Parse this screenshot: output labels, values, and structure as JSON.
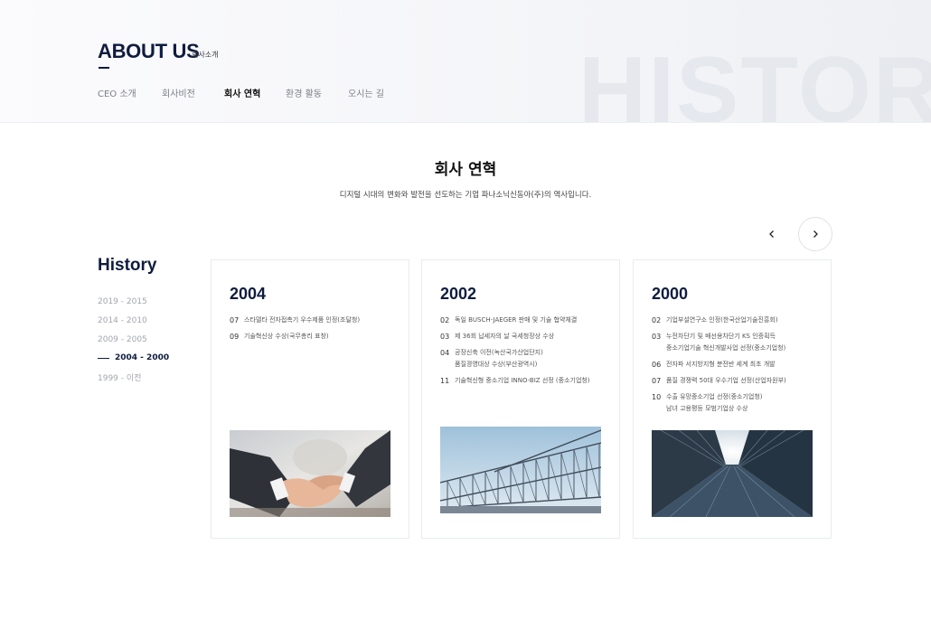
{
  "header": {
    "title": "ABOUT US",
    "subtitle": "회사소개",
    "background_word": "HISTORY",
    "tabs": [
      {
        "label": "CEO 소개",
        "active": false
      },
      {
        "label": "회사비전",
        "active": false
      },
      {
        "label": "회사 연혁",
        "active": true
      },
      {
        "label": "환경 활동",
        "active": false
      },
      {
        "label": "오시는 길",
        "active": false
      }
    ]
  },
  "section": {
    "title": "회사 연혁",
    "description": "디지털 시대의 변화와 발전을 선도하는 기업 파나소닉신동아(주)의 역사입니다."
  },
  "slider": {
    "prev_icon": "chevron-left-icon",
    "next_icon": "chevron-right-icon"
  },
  "history": {
    "title": "History",
    "periods": [
      {
        "label": "2019 - 2015",
        "active": false
      },
      {
        "label": "2014 - 2010",
        "active": false
      },
      {
        "label": "2009 - 2005",
        "active": false
      },
      {
        "label": "2004 - 2000",
        "active": true
      },
      {
        "label": "1999 - 이전",
        "active": false
      }
    ]
  },
  "cards": [
    {
      "year": "2004",
      "image": "handshake-photo",
      "entries": [
        {
          "month": "07",
          "lines": [
            "스타델타 전자접촉기 우수제품 인정(조달청)"
          ]
        },
        {
          "month": "09",
          "lines": [
            "기술혁신상 수상(국무총리 표창)"
          ]
        }
      ]
    },
    {
      "year": "2002",
      "image": "steel-frame-photo",
      "entries": [
        {
          "month": "02",
          "lines": [
            "독일 BUSCH-JAEGER 판매 및 기술 협약체결"
          ]
        },
        {
          "month": "03",
          "lines": [
            "제 36회 납세자의 날 국세청장상 수상"
          ]
        },
        {
          "month": "04",
          "lines": [
            "공장신축 이전(녹산국가산업단지)",
            "품질경영대상 수상(부산광역시)"
          ]
        },
        {
          "month": "11",
          "lines": [
            "기술혁신형 중소기업 INNO-BIZ 선정 (중소기업청)"
          ]
        }
      ]
    },
    {
      "year": "2000",
      "image": "skyscraper-photo",
      "entries": [
        {
          "month": "02",
          "lines": [
            "기업부설연구소 인정(한국산업기술진흥회)"
          ]
        },
        {
          "month": "03",
          "lines": [
            "누전차단기 및 배선용차단기 KS 인증획득",
            "중소기업기술 혁신개발사업 선정(중소기업청)"
          ]
        },
        {
          "month": "06",
          "lines": [
            "전자파 서지방지형 분전반 세계 최초 개발"
          ]
        },
        {
          "month": "07",
          "lines": [
            "품질 경쟁력 50대 우수기업 선정(산업자원부)"
          ]
        },
        {
          "month": "10",
          "lines": [
            "수출 유망중소기업 선정(중소기업청)",
            "남녀 고용평등 모범기업상 수상"
          ]
        }
      ]
    }
  ],
  "colors": {
    "navy": "#0f1c3f",
    "muted": "#a2a6ae",
    "border": "#e9ebef"
  }
}
